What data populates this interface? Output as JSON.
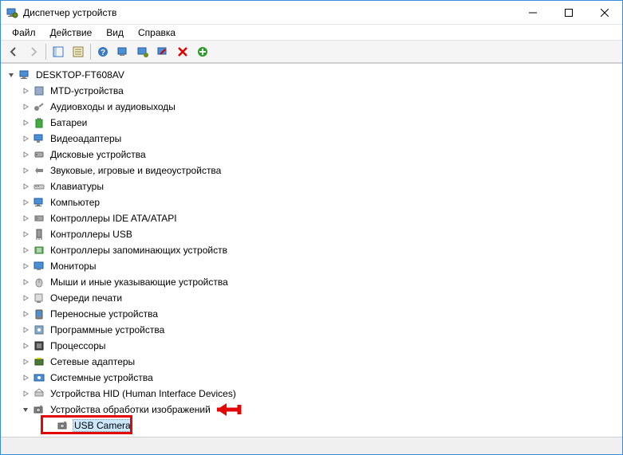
{
  "window": {
    "title": "Диспетчер устройств"
  },
  "menu": {
    "file": "Файл",
    "action": "Действие",
    "view": "Вид",
    "help": "Справка"
  },
  "tree": {
    "root": "DESKTOP-FT608AV",
    "categories": [
      "MTD-устройства",
      "Аудиовходы и аудиовыходы",
      "Батареи",
      "Видеоадаптеры",
      "Дисковые устройства",
      "Звуковые, игровые и видеоустройства",
      "Клавиатуры",
      "Компьютер",
      "Контроллеры IDE ATA/ATAPI",
      "Контроллеры USB",
      "Контроллеры запоминающих устройств",
      "Мониторы",
      "Мыши и иные указывающие устройства",
      "Очереди печати",
      "Переносные устройства",
      "Программные устройства",
      "Процессоры",
      "Сетевые адаптеры",
      "Системные устройства",
      "Устройства HID (Human Interface Devices)",
      "Устройства обработки изображений"
    ],
    "expanded_device": "USB Camera"
  }
}
